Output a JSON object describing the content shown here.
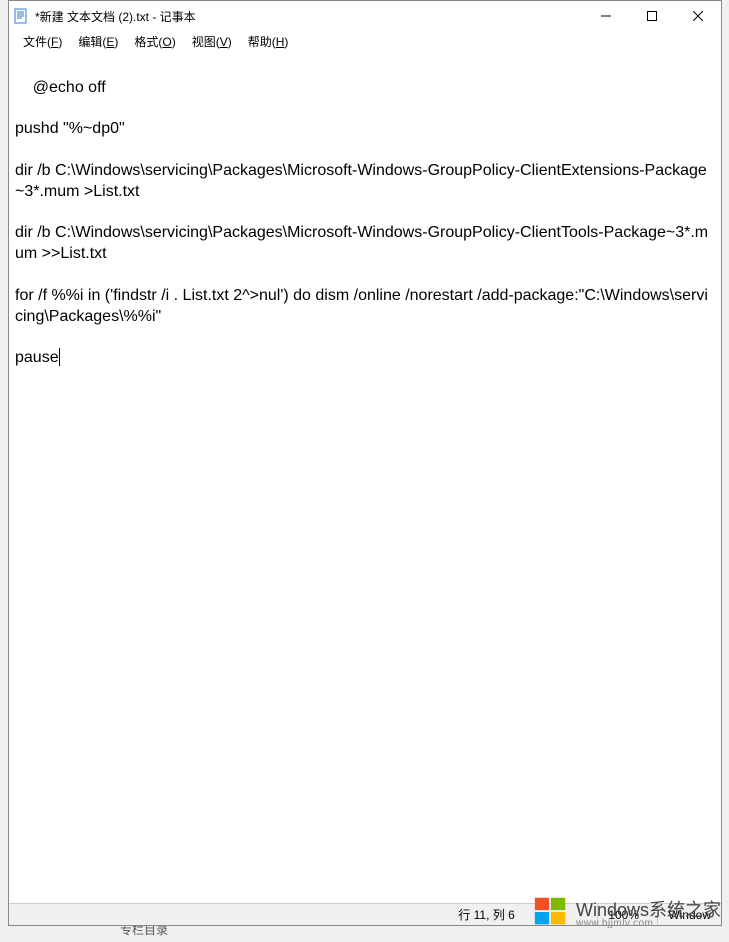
{
  "titlebar": {
    "title": "*新建 文本文档 (2).txt - 记事本"
  },
  "menu": {
    "file": "文件(F)",
    "edit": "编辑(E)",
    "format": "格式(O)",
    "view": "视图(V)",
    "help": "帮助(H)"
  },
  "content": "@echo off\n\npushd \"%~dp0\"\n\ndir /b C:\\Windows\\servicing\\Packages\\Microsoft-Windows-GroupPolicy-ClientExtensions-Package~3*.mum >List.txt\n\ndir /b C:\\Windows\\servicing\\Packages\\Microsoft-Windows-GroupPolicy-ClientTools-Package~3*.mum >>List.txt\n\nfor /f %%i in ('findstr /i . List.txt 2^>nul') do dism /online /norestart /add-package:\"C:\\Windows\\servicing\\Packages\\%%i\"\n\npause",
  "statusbar": {
    "position": "行 11, 列 6",
    "zoom": "100%",
    "encoding": "Window"
  },
  "watermark": {
    "main": "Windows系统之家",
    "sub": "www.bjjmlv.com"
  },
  "bg": {
    "frag1": "专栏目录"
  }
}
